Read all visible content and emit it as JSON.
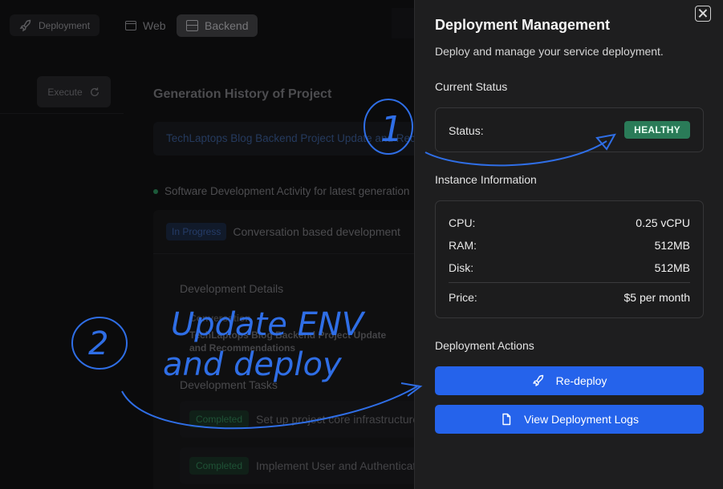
{
  "topbar": {
    "deployment_label": "Deployment",
    "web_tab": "Web",
    "backend_tab": "Backend"
  },
  "left": {
    "execute_label": "Execute"
  },
  "history": {
    "title": "Generation History of Project",
    "project_name": "TechLaptops Blog Backend Project Update and Recommendations",
    "activity": "Software Development Activity for latest generation",
    "status_badge": "In Progress",
    "status_text": "Conversation based development",
    "development_details": "Development Details",
    "conversation_label": "Conversation",
    "conversation_text": "TechLaptops Blog Backend Project Update and Recommendations",
    "development_tasks": "Development Tasks",
    "tasks": [
      {
        "badge": "Completed",
        "text": "Set up project core infrastructure"
      },
      {
        "badge": "Completed",
        "text": "Implement User and Authentication"
      }
    ]
  },
  "drawer": {
    "title": "Deployment Management",
    "subtitle": "Deploy and manage your service deployment.",
    "current_status_heading": "Current Status",
    "status_label": "Status:",
    "status_value": "HEALTHY",
    "instance_heading": "Instance Information",
    "instance": [
      {
        "label": "CPU:",
        "value": "0.25 vCPU"
      },
      {
        "label": "RAM:",
        "value": "512MB"
      },
      {
        "label": "Disk:",
        "value": "512MB"
      },
      {
        "label": "Price:",
        "value": "$5 per month"
      }
    ],
    "actions_heading": "Deployment Actions",
    "redeploy_label": "Re-deploy",
    "logs_label": "View Deployment Logs"
  },
  "annotations": {
    "step1": "1",
    "step2": "2",
    "note_line1": "Update ENV",
    "note_line2": "and deploy"
  },
  "colors": {
    "accent": "#2563eb",
    "healthy": "#2a7b58",
    "ink": "#2f6ee6"
  }
}
